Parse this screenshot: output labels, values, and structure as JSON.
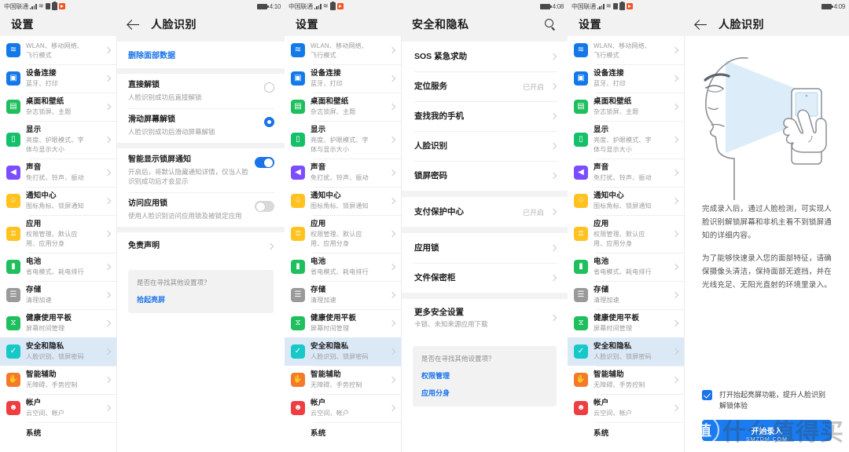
{
  "statusbars": {
    "carrier": "中国联通",
    "time_p1": "4:10",
    "time_p2": "4:08",
    "time_p3": "4:09"
  },
  "settings_menu": {
    "title": "设置",
    "items": [
      {
        "name": "wlan",
        "title": "WLAN、移动网络、",
        "title2": "飞行模式",
        "sub": "",
        "icon": "wifi-icon",
        "icon_class": "ic-wlan",
        "glyph": "≋",
        "clipped": true,
        "subtitle_lines": [
          "WLAN、移动网络、",
          "飞行模式"
        ]
      },
      {
        "name": "device-connect",
        "title": "设备连接",
        "sub": "蓝牙、打印",
        "icon": "device-icon",
        "icon_class": "ic-dev",
        "glyph": "▣"
      },
      {
        "name": "desktop-wallpaper",
        "title": "桌面和壁纸",
        "sub": "杂志锁屏、主题",
        "icon": "wallpaper-icon",
        "icon_class": "ic-desk",
        "glyph": "▤"
      },
      {
        "name": "display",
        "title": "显示",
        "sub": "亮度、护眼模式、字",
        "sub2": "体与显示大小",
        "icon": "display-icon",
        "icon_class": "ic-disp",
        "glyph": "▯"
      },
      {
        "name": "sound",
        "title": "声音",
        "sub": "免打扰、铃声、振动",
        "icon": "sound-icon",
        "icon_class": "ic-sound",
        "glyph": "◀"
      },
      {
        "name": "notification-center",
        "title": "通知中心",
        "sub": "图标角标、锁屏通知",
        "icon": "bell-icon",
        "icon_class": "ic-notif",
        "glyph": "♤"
      },
      {
        "name": "apps",
        "title": "应用",
        "sub": "权限管理、默认应",
        "sub2": "用、应用分身",
        "icon": "apps-icon",
        "icon_class": "ic-app",
        "glyph": "⦂⦂"
      },
      {
        "name": "battery",
        "title": "电池",
        "sub": "省电模式、耗电排行",
        "icon": "battery-icon",
        "icon_class": "ic-batt",
        "glyph": "▮"
      },
      {
        "name": "storage",
        "title": "存储",
        "sub": "清理加速",
        "icon": "storage-icon",
        "icon_class": "ic-store",
        "glyph": "☰"
      },
      {
        "name": "digital-balance",
        "title": "健康使用平板",
        "sub": "屏幕时间管理",
        "icon": "hourglass-icon",
        "icon_class": "ic-health",
        "glyph": "⧖"
      },
      {
        "name": "security-privacy",
        "title": "安全和隐私",
        "sub": "人脸识别、锁屏密码",
        "icon": "shield-icon",
        "icon_class": "ic-sec",
        "glyph": "✓",
        "selected": true
      },
      {
        "name": "smart-assistance",
        "title": "智能辅助",
        "sub": "无障碍、手势控制",
        "icon": "hand-icon",
        "icon_class": "ic-assist",
        "glyph": "✋"
      },
      {
        "name": "accounts",
        "title": "帐户",
        "sub": "云空间、帐户",
        "icon": "person-icon",
        "icon_class": "ic-acct",
        "glyph": "☻"
      },
      {
        "name": "system",
        "title": "系统",
        "sub": "",
        "icon": "",
        "icon_class": "",
        "glyph": ""
      }
    ]
  },
  "face_settings": {
    "title": "人脸识别",
    "delete_link": "删除面部数据",
    "options": [
      {
        "name": "direct-unlock",
        "title": "直接解锁",
        "sub": "人脸识别成功后直接解锁",
        "control": "radio",
        "on": false
      },
      {
        "name": "slide-unlock",
        "title": "滑动屏幕解锁",
        "sub": "人脸识别成功后滑动屏幕解锁",
        "control": "radio",
        "on": true
      }
    ],
    "toggles": [
      {
        "name": "smart-lockscreen-notification",
        "title": "智能显示锁屏通知",
        "sub": "开启后，将默认隐藏通知详情，仅当人脸识别成功后才会显示",
        "control": "toggle",
        "on": true
      },
      {
        "name": "app-lock-access",
        "title": "访问应用锁",
        "sub": "使用人脸识别访问应用锁及被锁定应用",
        "control": "toggle",
        "on": false
      }
    ],
    "disclaimer": "免责声明",
    "suggestion": {
      "question": "是否在寻找其他设置项？",
      "links": [
        "拾起亮屏"
      ]
    }
  },
  "security_privacy": {
    "title": "安全和隐私",
    "search_icon": "search-icon",
    "groups": [
      {
        "items": [
          {
            "name": "sos-emergency",
            "title": "SOS 紧急求助",
            "state": ""
          },
          {
            "name": "location-service",
            "title": "定位服务",
            "state": "已开启"
          },
          {
            "name": "find-my-phone",
            "title": "查找我的手机",
            "state": ""
          },
          {
            "name": "face-recognition",
            "title": "人脸识别",
            "state": ""
          },
          {
            "name": "lockscreen-password",
            "title": "锁屏密码",
            "state": ""
          }
        ]
      },
      {
        "items": [
          {
            "name": "payment-protection",
            "title": "支付保护中心",
            "state": "已开启"
          }
        ]
      },
      {
        "items": [
          {
            "name": "app-lock",
            "title": "应用锁",
            "state": ""
          },
          {
            "name": "file-safe",
            "title": "文件保密柜",
            "state": ""
          }
        ]
      },
      {
        "items": [
          {
            "name": "more-security-settings",
            "title": "更多安全设置",
            "sub": "卡锁、未知来源应用下载",
            "state": ""
          }
        ]
      }
    ],
    "suggestion": {
      "question": "是否在寻找其他设置项？",
      "links": [
        "权限管理",
        "应用分身"
      ]
    }
  },
  "face_intro": {
    "title": "人脸识别",
    "illustration": "face-scan-illustration",
    "paragraphs": [
      "完成录入后，通过人脸检测，可实现人脸识别解锁屏幕和非机主看不到锁屏通知的详细内容。",
      "为了能够快速录入您的面部特征，请确保摄像头清洁，保持面部无遮挡，并在光线充足、无阳光直射的环境里录入。"
    ],
    "checkbox": {
      "label": "打开抬起亮屏功能，提升人脸识别解锁体验",
      "checked": true
    },
    "button_label": "开始录入"
  },
  "watermark": {
    "text": "什么值得买",
    "badge": "值",
    "sub": "SMZDM.COM"
  },
  "colors": {
    "accent_blue": "#1a73e8",
    "button_blue": "#1a7cf0",
    "selected_row": "#dbe9f7",
    "grey_bg": "#f2f2f2"
  }
}
